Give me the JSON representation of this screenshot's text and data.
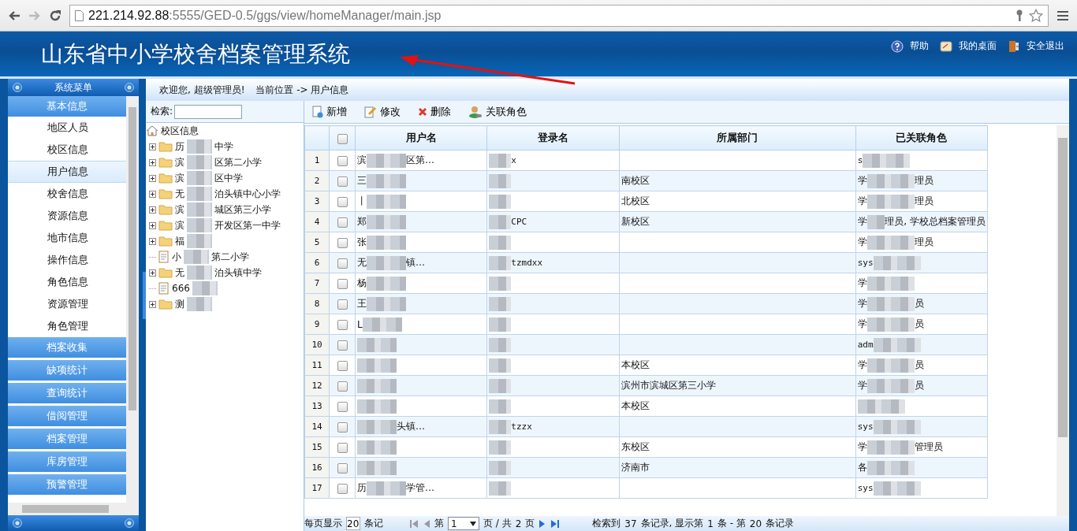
{
  "browser": {
    "url_host": "221.214.92.88",
    "url_rest": ":5555/GED-0.5/ggs/view/homeManager/main.jsp"
  },
  "header": {
    "title": "山东省中小学校舍档案管理系统",
    "links": [
      "帮助",
      "我的桌面",
      "安全退出"
    ]
  },
  "breadcrumb": {
    "welcome": "欢迎您,  超级管理员!",
    "location": "当前位置 -> 用户信息"
  },
  "sidebar": {
    "title": "系统菜单",
    "groups": [
      {
        "label": "基本信息",
        "expanded": true,
        "items": [
          {
            "label": "地区人员",
            "selected": false
          },
          {
            "label": "校区信息",
            "selected": false
          },
          {
            "label": "用户信息",
            "selected": true
          },
          {
            "label": "校舍信息",
            "selected": false
          },
          {
            "label": "资源信息",
            "selected": false
          },
          {
            "label": "地市信息",
            "selected": false
          },
          {
            "label": "操作信息",
            "selected": false
          },
          {
            "label": "角色信息",
            "selected": false
          },
          {
            "label": "资源管理",
            "selected": false
          },
          {
            "label": "角色管理",
            "selected": false
          }
        ]
      },
      {
        "label": "档案收集",
        "expanded": false
      },
      {
        "label": "缺项统计",
        "expanded": false
      },
      {
        "label": "查询统计",
        "expanded": false
      },
      {
        "label": "借阅管理",
        "expanded": false
      },
      {
        "label": "档案管理",
        "expanded": false
      },
      {
        "label": "库房管理",
        "expanded": false
      },
      {
        "label": "预警管理",
        "expanded": false
      }
    ]
  },
  "tree": {
    "search_label": "检索:",
    "root": "校区信息",
    "children": [
      {
        "kind": "folder",
        "before": "历",
        "after": "中学"
      },
      {
        "kind": "folder",
        "before": "滨",
        "after": "区第二小学"
      },
      {
        "kind": "folder",
        "before": "滨",
        "after": "区中学"
      },
      {
        "kind": "folder",
        "before": "无",
        "after": "泊头镇中心小学"
      },
      {
        "kind": "folder",
        "before": "滨",
        "after": "城区第三小学"
      },
      {
        "kind": "folder",
        "before": "滨",
        "after": "开发区第一中学"
      },
      {
        "kind": "folder",
        "before": "福"
      },
      {
        "kind": "leaf",
        "before": "小",
        "after": "第二小学"
      },
      {
        "kind": "folder",
        "before": "无",
        "after": "泊头镇中学"
      },
      {
        "kind": "leaf",
        "before": "666"
      },
      {
        "kind": "folder",
        "before": "测"
      }
    ]
  },
  "toolbar": [
    {
      "kind": "add",
      "label": "新增"
    },
    {
      "kind": "edit",
      "label": "修改"
    },
    {
      "kind": "delete",
      "label": "删除"
    },
    {
      "kind": "role",
      "label": "关联角色"
    }
  ],
  "table": {
    "columns": [
      "用户名",
      "登录名",
      "所属部门",
      "已关联角色"
    ],
    "select_all_checked": false,
    "rows": [
      {
        "n": "1",
        "checked": false,
        "user": {
          "before": "滨",
          "after": "区第…"
        },
        "login": {
          "after": "x"
        },
        "role": {
          "before": "s"
        }
      },
      {
        "n": "2",
        "checked": false,
        "user": {
          "before": "三"
        },
        "login": {},
        "dept": "南校区",
        "role": {
          "before": "学",
          "after": "理员"
        }
      },
      {
        "n": "3",
        "checked": false,
        "user": {
          "before": "丨"
        },
        "login": {},
        "dept": "北校区",
        "role": {
          "before": "学",
          "after": "理员"
        }
      },
      {
        "n": "4",
        "checked": false,
        "user": {
          "before": "郑"
        },
        "login": {
          "after": "CPC"
        },
        "dept": "新校区",
        "role": {
          "before": "学",
          "after": "理员, 学校总档案管理员"
        }
      },
      {
        "n": "5",
        "checked": false,
        "user": {
          "before": "张"
        },
        "login": {},
        "role": {
          "before": "学",
          "after": "理员"
        }
      },
      {
        "n": "6",
        "checked": false,
        "user": {
          "before": "无",
          "after": "镇…"
        },
        "login": {
          "after": "tzmdxx"
        },
        "role": {
          "before": "sys"
        }
      },
      {
        "n": "7",
        "checked": false,
        "user": {
          "before": "杨"
        },
        "login": {},
        "role": {
          "before": "学"
        }
      },
      {
        "n": "8",
        "checked": false,
        "user": {
          "before": "王"
        },
        "login": {},
        "role": {
          "before": "学",
          "after": "员"
        }
      },
      {
        "n": "9",
        "checked": false,
        "user": {
          "before": "L"
        },
        "login": {},
        "role": {
          "before": "学",
          "after": "员"
        }
      },
      {
        "n": "10",
        "checked": false,
        "user": {},
        "login": {},
        "role": {
          "before": "adm"
        }
      },
      {
        "n": "11",
        "checked": false,
        "user": {},
        "login": {},
        "dept": "本校区",
        "role": {
          "before": "学",
          "after": "员"
        }
      },
      {
        "n": "12",
        "checked": false,
        "user": {},
        "login": {},
        "dept": "滨州市滨城区第三小学",
        "role": {
          "before": "学",
          "after": "员"
        }
      },
      {
        "n": "13",
        "checked": false,
        "user": {},
        "login": {},
        "dept": "本校区",
        "role": {}
      },
      {
        "n": "14",
        "checked": false,
        "user": {
          "after": "头镇…"
        },
        "login": {
          "after": "tzzx"
        },
        "role": {
          "before": "sys"
        }
      },
      {
        "n": "15",
        "checked": false,
        "user": {},
        "login": {},
        "dept": "东校区",
        "role": {
          "before": "学",
          "after": "管理员"
        }
      },
      {
        "n": "16",
        "checked": false,
        "user": {},
        "login": {},
        "dept": "济南市",
        "role": {
          "before": "各"
        }
      },
      {
        "n": "17",
        "checked": false,
        "user": {
          "before": "历",
          "after": "学管…"
        },
        "login": {},
        "role": {
          "before": "sys"
        }
      }
    ]
  },
  "pager": {
    "per_page_label": "每页显示",
    "per_page": "20",
    "per_page_unit": "条记",
    "page_label": "第",
    "page": "1",
    "of_label": "页 / 共",
    "pages": "2",
    "pages_unit": "页",
    "found_label": "检索到",
    "found": "37",
    "shown_label": "条记录, 显示第",
    "from": "1",
    "to_label": "条 - 第",
    "to": "20",
    "end_label": "条记录"
  }
}
